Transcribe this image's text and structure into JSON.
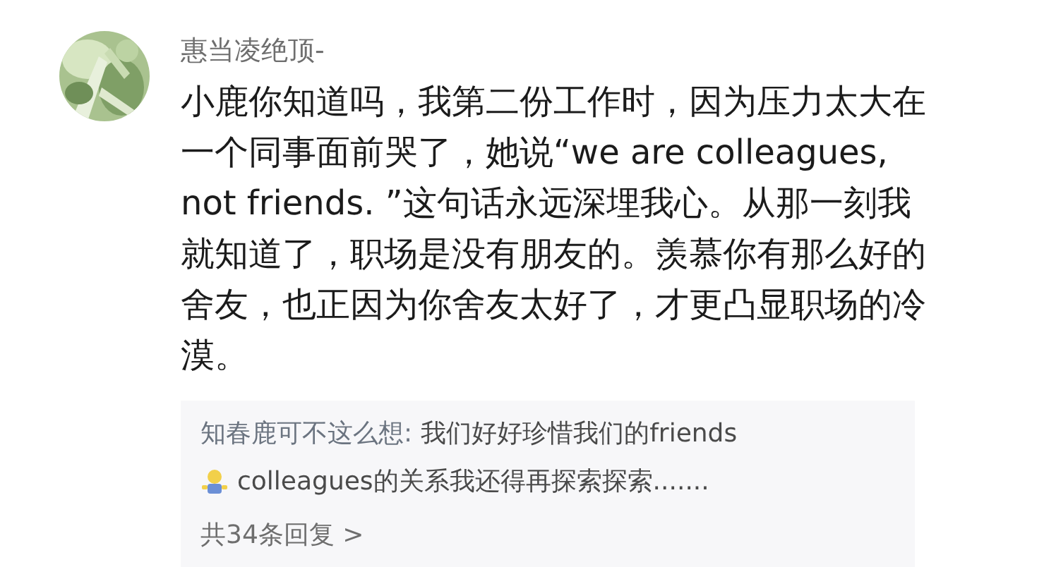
{
  "comment": {
    "author": "惠当凌绝顶-",
    "text": "小鹿你知道吗，我第二份工作时，因为压力太大在一个同事面前哭了，她说“we are colleagues, not friends. ”这句话永远深埋我心。从那一刻我就知道了，职场是没有朋友的。羡慕你有那么好的舍友，也正因为你舍友太好了，才更凸显职场的冷漠。"
  },
  "reply": {
    "author": "知春鹿可不这么想:",
    "text": "我们好好珍惜我们的friends",
    "text_after_emoji": "colleagues的关系我还得再探索探索.......",
    "more": "共34条回复 >"
  }
}
